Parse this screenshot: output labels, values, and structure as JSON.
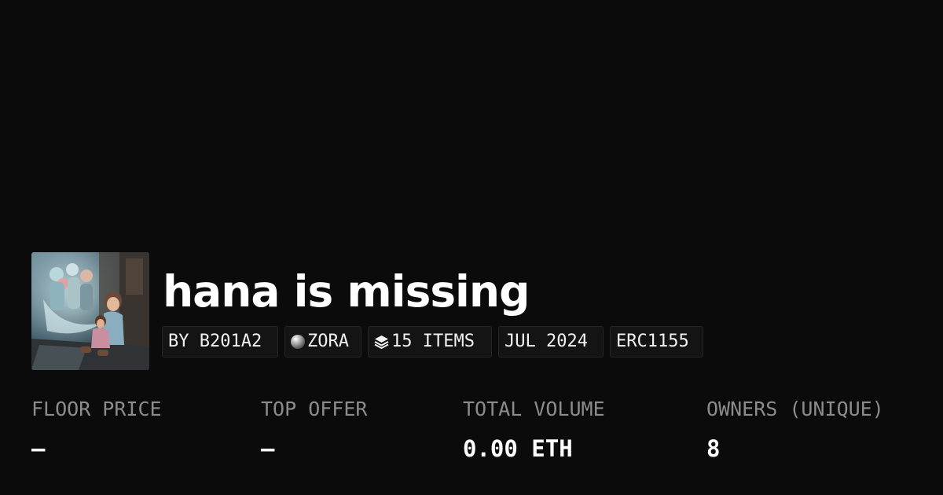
{
  "collection": {
    "title": "hana is missing",
    "tags": {
      "creator": "BY B201A2",
      "chain": "ZORA",
      "items": "15 ITEMS",
      "date": "JUL 2024",
      "standard": "ERC1155"
    }
  },
  "stats": [
    {
      "label": "FLOOR PRICE",
      "value": "–"
    },
    {
      "label": "TOP OFFER",
      "value": "–"
    },
    {
      "label": "TOTAL VOLUME",
      "value": "0.00 ETH"
    },
    {
      "label": "OWNERS (UNIQUE)",
      "value": "8"
    }
  ],
  "icons": {
    "chain": "zora-orb-icon",
    "items": "layers-icon"
  },
  "colors": {
    "background": "#0b0b0b",
    "text": "#ffffff",
    "muted": "#8c8c8c",
    "tag_background": "#141414",
    "tag_border": "#262626"
  }
}
